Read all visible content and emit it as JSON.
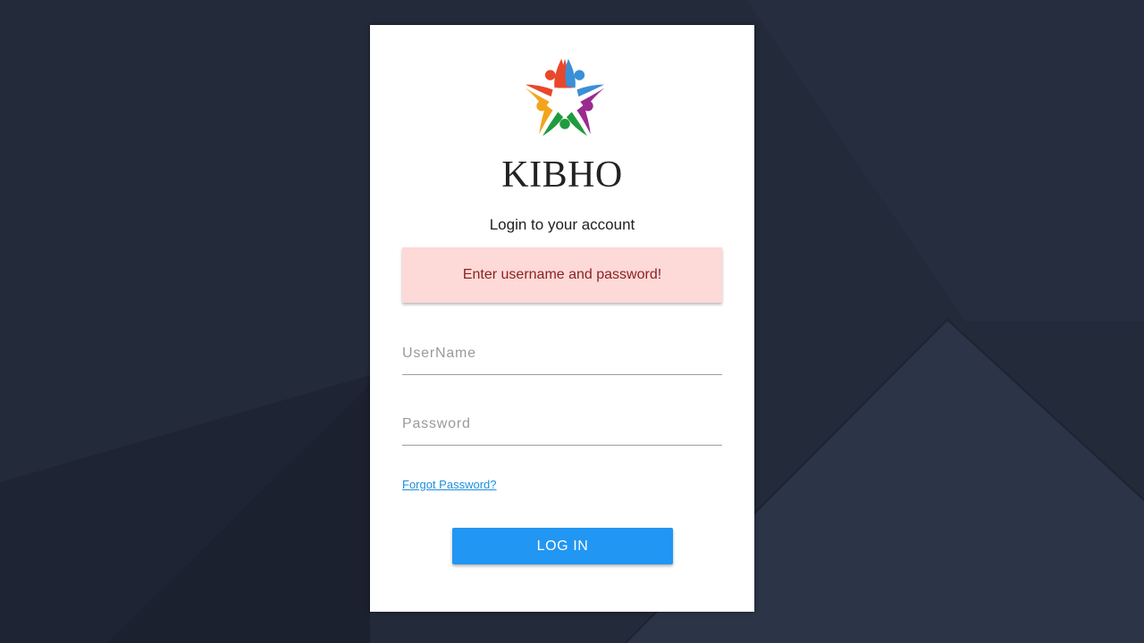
{
  "brand": {
    "name": "KIBHO",
    "logo_icon": "kibho-people-star-logo-icon",
    "logo_colors": [
      "#e8472b",
      "#3a8fd6",
      "#9b2a8f",
      "#1f9b3f",
      "#f2a51c"
    ]
  },
  "login": {
    "subtitle": "Login to your account",
    "alert_message": "Enter username and password!",
    "username_placeholder": "UserName",
    "password_placeholder": "Password",
    "username_value": "",
    "password_value": "",
    "forgot_link": "Forgot Password?",
    "submit_label": "LOG IN"
  },
  "colors": {
    "background": "#232a3a",
    "card": "#ffffff",
    "alert_bg": "#fdd9d7",
    "alert_text": "#8a2323",
    "link": "#1a8fe0",
    "button": "#2196f3"
  }
}
